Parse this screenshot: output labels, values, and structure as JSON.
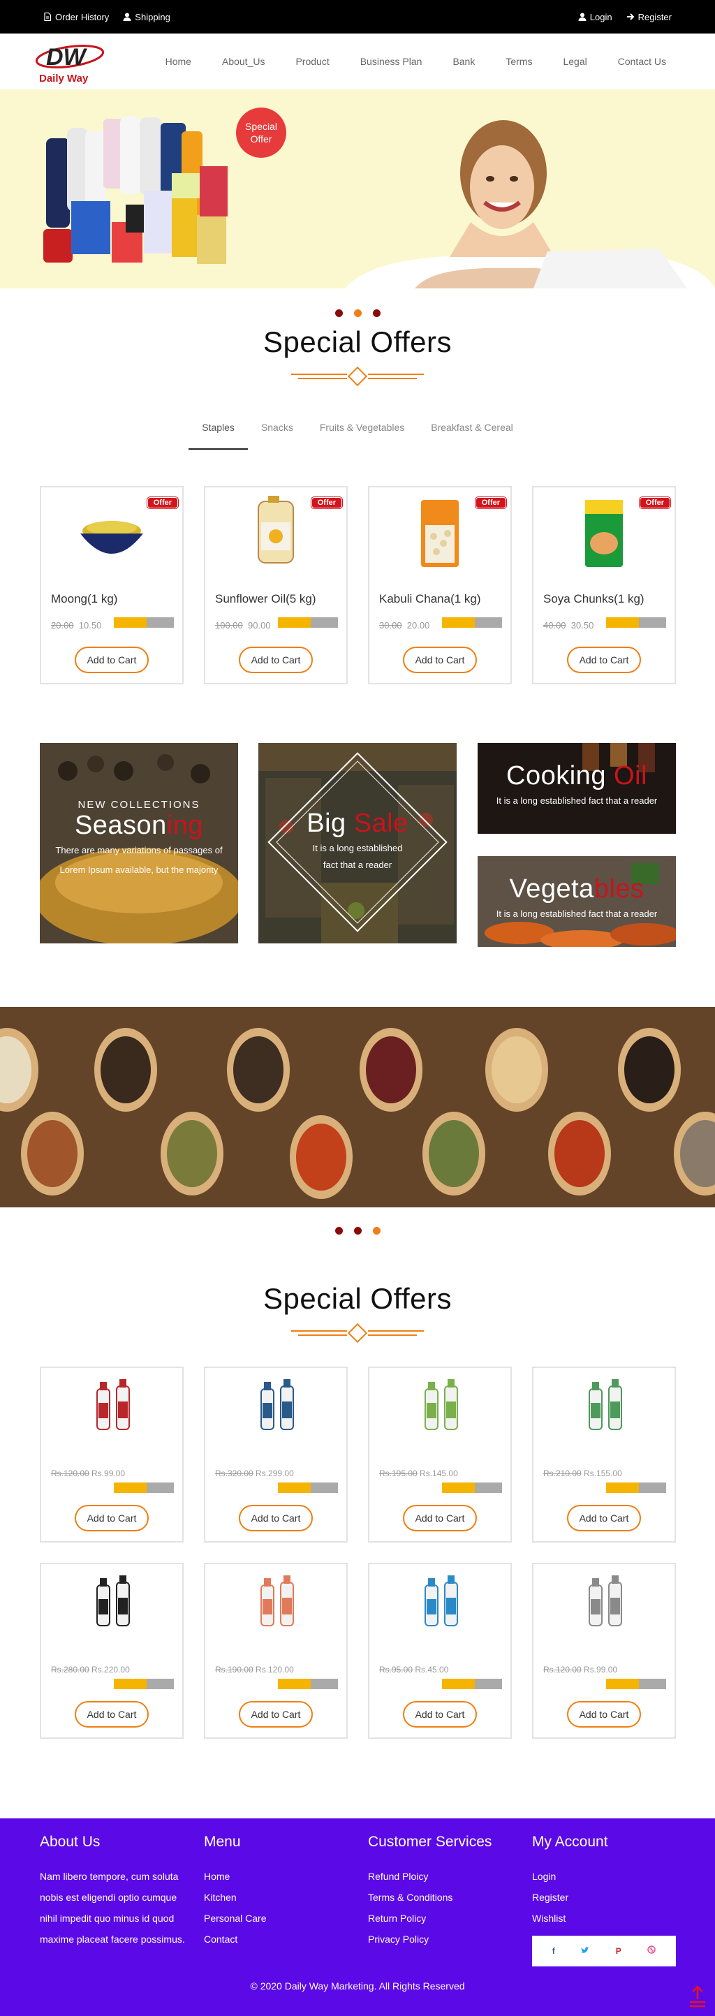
{
  "topbar": {
    "order_history": "Order History",
    "shipping": "Shipping",
    "login": "Login",
    "register": "Register"
  },
  "brand": {
    "logo_letters": "DW",
    "name": "Daily Way"
  },
  "nav": [
    "Home",
    "About_Us",
    "Product",
    "Business Plan",
    "Bank",
    "Terms",
    "Legal",
    "Contact Us"
  ],
  "hero": {
    "badge_line1": "Special",
    "badge_line2": "Offer"
  },
  "section1": {
    "title": "Special Offers",
    "tabs": [
      "Staples",
      "Snacks",
      "Fruits & Vegetables",
      "Breakfast & Cereal"
    ],
    "active_tab": "Staples",
    "products": [
      {
        "name": "Moong(1 kg)",
        "old_price": "20.00",
        "price": "10.50",
        "tag": "Offer",
        "stock_fill": 0.55
      },
      {
        "name": "Sunflower Oil(5 kg)",
        "old_price": "100.00",
        "price": "90.00",
        "tag": "Offer",
        "stock_fill": 0.55
      },
      {
        "name": "Kabuli Chana(1 kg)",
        "old_price": "30.00",
        "price": "20.00",
        "tag": "Offer",
        "stock_fill": 0.55
      },
      {
        "name": "Soya Chunks(1 kg)",
        "old_price": "40.00",
        "price": "30.50",
        "tag": "Offer",
        "stock_fill": 0.55
      }
    ],
    "add_to_cart": "Add to Cart"
  },
  "promos": {
    "seasoning": {
      "kicker": "NEW COLLECTIONS",
      "title_a": "Season",
      "title_b": "ing",
      "text1": "There are many variations of passages of",
      "text2": "Lorem Ipsum available, but the majority"
    },
    "bigsale": {
      "title_a": "Big ",
      "title_b": "Sale",
      "text1": "It is a long established",
      "text2": "fact that a reader"
    },
    "cooking": {
      "title_a": "Cooking ",
      "title_b": "Oil",
      "text": "It is a long established fact that a reader"
    },
    "vegetables": {
      "title_a": "Vegeta",
      "title_b": "bles",
      "text": "It is a long established fact that a reader"
    }
  },
  "section2": {
    "title": "Special Offers",
    "products": [
      {
        "old_price": "Rs.120.00",
        "price": "Rs.99.00",
        "stock_fill": 0.55,
        "color": "#b8282a"
      },
      {
        "old_price": "Rs.320.00",
        "price": "Rs.299.00",
        "stock_fill": 0.55,
        "color": "#2a5a8a"
      },
      {
        "old_price": "Rs.195.00",
        "price": "Rs.145.00",
        "stock_fill": 0.55,
        "color": "#7ab04a"
      },
      {
        "old_price": "Rs.210.00",
        "price": "Rs.155.00",
        "stock_fill": 0.55,
        "color": "#4e9a5a"
      },
      {
        "old_price": "Rs.280.00",
        "price": "Rs.220.00",
        "stock_fill": 0.55,
        "color": "#222222"
      },
      {
        "old_price": "Rs.190.00",
        "price": "Rs.120.00",
        "stock_fill": 0.55,
        "color": "#e07a5a"
      },
      {
        "old_price": "Rs.95.00",
        "price": "Rs.45.00",
        "stock_fill": 0.55,
        "color": "#2a8ac8"
      },
      {
        "old_price": "Rs.120.00",
        "price": "Rs.99.00",
        "stock_fill": 0.55,
        "color": "#8a8a8a"
      }
    ],
    "add_to_cart": "Add to Cart"
  },
  "footer": {
    "about_title": "About Us",
    "about_text": "Nam libero tempore, cum soluta nobis est eligendi optio cumque nihil impedit quo minus id quod maxime placeat facere possimus.",
    "menu_title": "Menu",
    "menu_items": [
      "Home",
      "Kitchen",
      "Personal Care",
      "Contact"
    ],
    "cs_title": "Customer Services",
    "cs_items": [
      "Refund Ploicy",
      "Terms & Conditions",
      "Return Policy",
      "Privacy Policy"
    ],
    "account_title": "My Account",
    "account_items": [
      "Login",
      "Register",
      "Wishlist"
    ],
    "social_icons": [
      "facebook-icon",
      "twitter-icon",
      "pinterest-icon",
      "dribbble-icon"
    ],
    "copyright": "© 2020 Daily Way Marketing. All Rights Reserved"
  },
  "colors": {
    "accent_orange": "#f07e12",
    "offer_red": "#d4141c",
    "footer_purple": "#5c09e8",
    "hero_cream": "#fbf8cf",
    "dot_dark": "#8b0a0a",
    "dot_orange": "#ef7e1a"
  }
}
